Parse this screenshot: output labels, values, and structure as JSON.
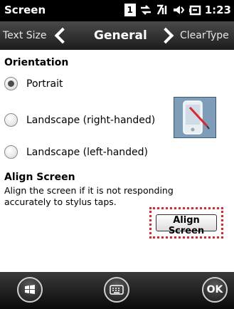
{
  "status_bar": {
    "title": "Screen",
    "sim_badge": "1",
    "time": "1:23"
  },
  "tabs": {
    "previous": "Text Size",
    "current": "General",
    "next": "ClearType"
  },
  "orientation": {
    "heading": "Orientation",
    "options": [
      {
        "label": "Portrait",
        "selected": true
      },
      {
        "label": "Landscape (right-handed)",
        "selected": false
      },
      {
        "label": "Landscape (left-handed)",
        "selected": false
      }
    ]
  },
  "align_screen": {
    "heading": "Align Screen",
    "description": "Align the screen if it is not responding accurately to stylus taps.",
    "button_label": "Align Screen"
  },
  "softkeys": {
    "ok_label": "OK"
  },
  "colors": {
    "highlight_border": "#e0242b"
  }
}
